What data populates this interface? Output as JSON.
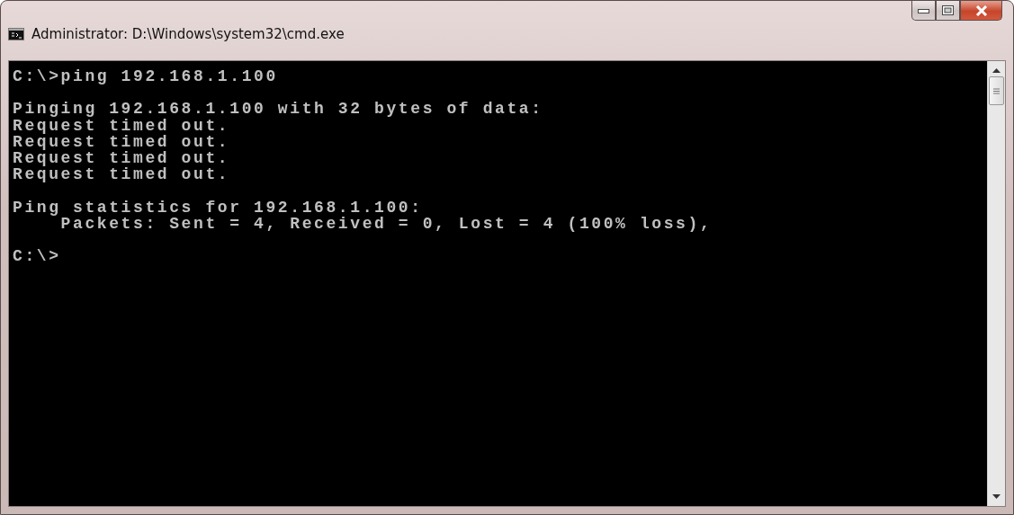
{
  "window": {
    "title": "Administrator: D:\\Windows\\system32\\cmd.exe"
  },
  "console": {
    "blocks": [
      [
        "C:\\>ping 192.168.1.100"
      ],
      [
        "Pinging 192.168.1.100 with 32 bytes of data:",
        "Request timed out.",
        "Request timed out.",
        "Request timed out.",
        "Request timed out."
      ],
      [
        "Ping statistics for 192.168.1.100:",
        "    Packets: Sent = 4, Received = 0, Lost = 4 (100% loss),"
      ],
      [
        "C:\\>"
      ]
    ]
  }
}
